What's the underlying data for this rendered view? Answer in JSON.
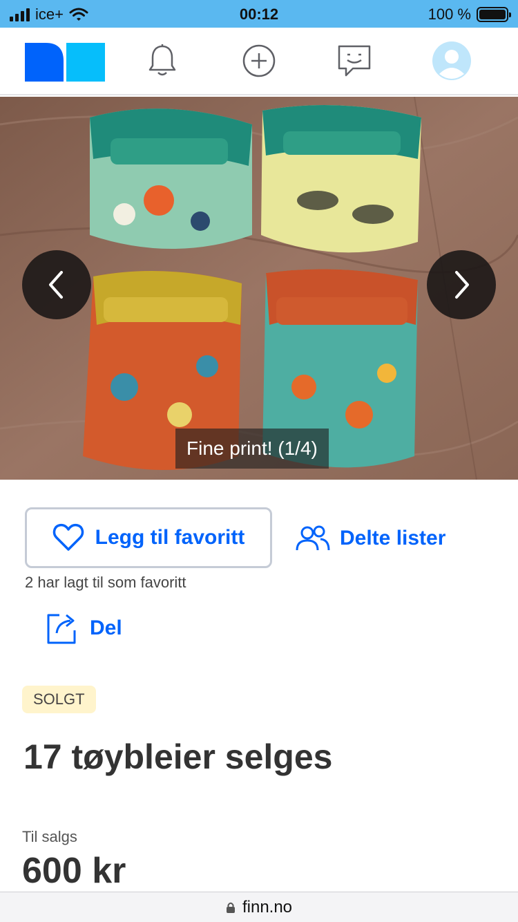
{
  "status_bar": {
    "carrier": "ice+",
    "time": "00:12",
    "battery": "100 %"
  },
  "nav": {
    "logo_name": "finn-logo",
    "icons": [
      "bell-icon",
      "plus-circle-icon",
      "chat-icon",
      "profile-icon"
    ]
  },
  "gallery": {
    "caption": "Fine print! (1/4)"
  },
  "actions": {
    "favorite_label": "Legg til favoritt",
    "shared_lists_label": "Delte lister",
    "favorite_count_text": "2 har lagt til som favoritt",
    "share_label": "Del"
  },
  "listing": {
    "status_badge": "SOLGT",
    "title": "17 tøybleier selges",
    "price_label": "Til salgs",
    "price": "600 kr"
  },
  "browser": {
    "url": "finn.no"
  },
  "colors": {
    "accent": "#0063fb",
    "status_bar": "#5ab8f0",
    "badge_bg": "#fff4cc"
  }
}
